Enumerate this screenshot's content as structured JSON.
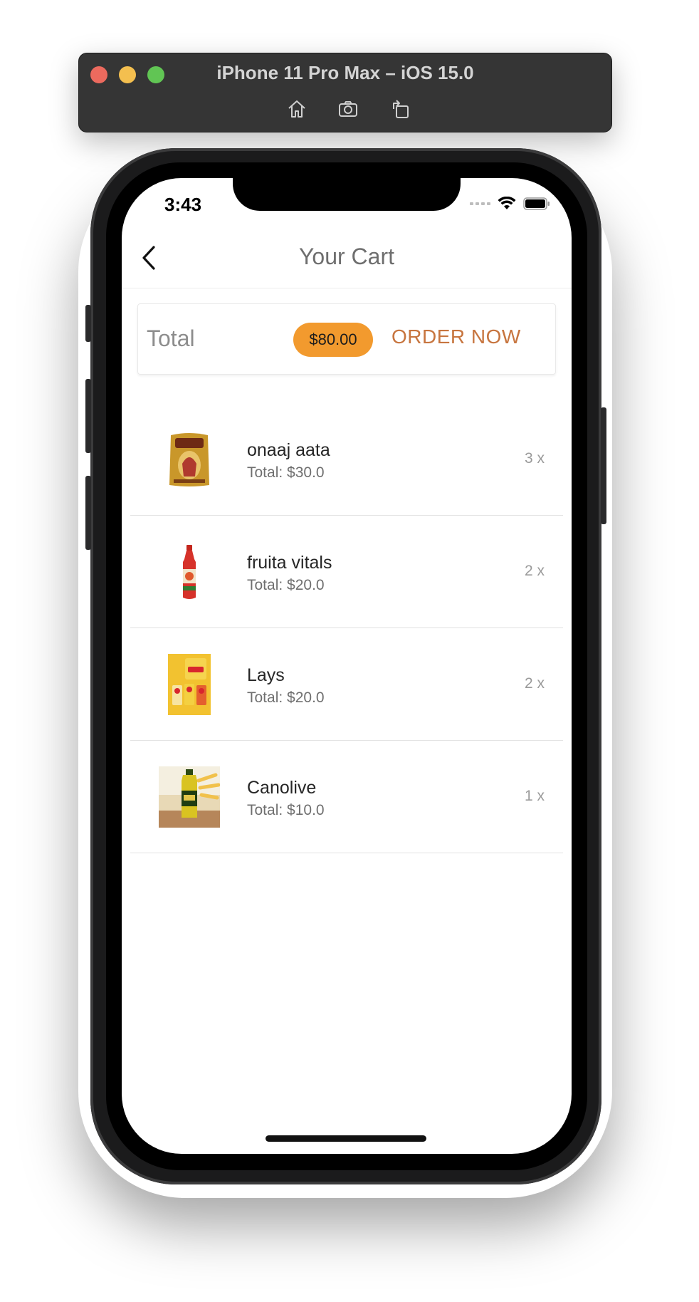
{
  "simulator": {
    "title": "iPhone 11 Pro Max – iOS 15.0",
    "buttons": [
      "home-icon",
      "screenshot-icon",
      "rotate-icon"
    ]
  },
  "status_bar": {
    "time": "3:43"
  },
  "app_bar": {
    "title": "Your Cart"
  },
  "summary": {
    "total_label": "Total",
    "total_amount": "$80.00",
    "order_button": "ORDER NOW"
  },
  "cart_items": [
    {
      "name": "onaaj aata",
      "total": "Total: $30.0",
      "quantity": "3 x"
    },
    {
      "name": "fruita vitals",
      "total": "Total: $20.0",
      "quantity": "2 x"
    },
    {
      "name": "Lays",
      "total": "Total: $20.0",
      "quantity": "2 x"
    },
    {
      "name": "Canolive",
      "total": "Total: $10.0",
      "quantity": "1 x"
    }
  ],
  "colors": {
    "accent": "#f29a2e",
    "order_text": "#c7753f"
  }
}
